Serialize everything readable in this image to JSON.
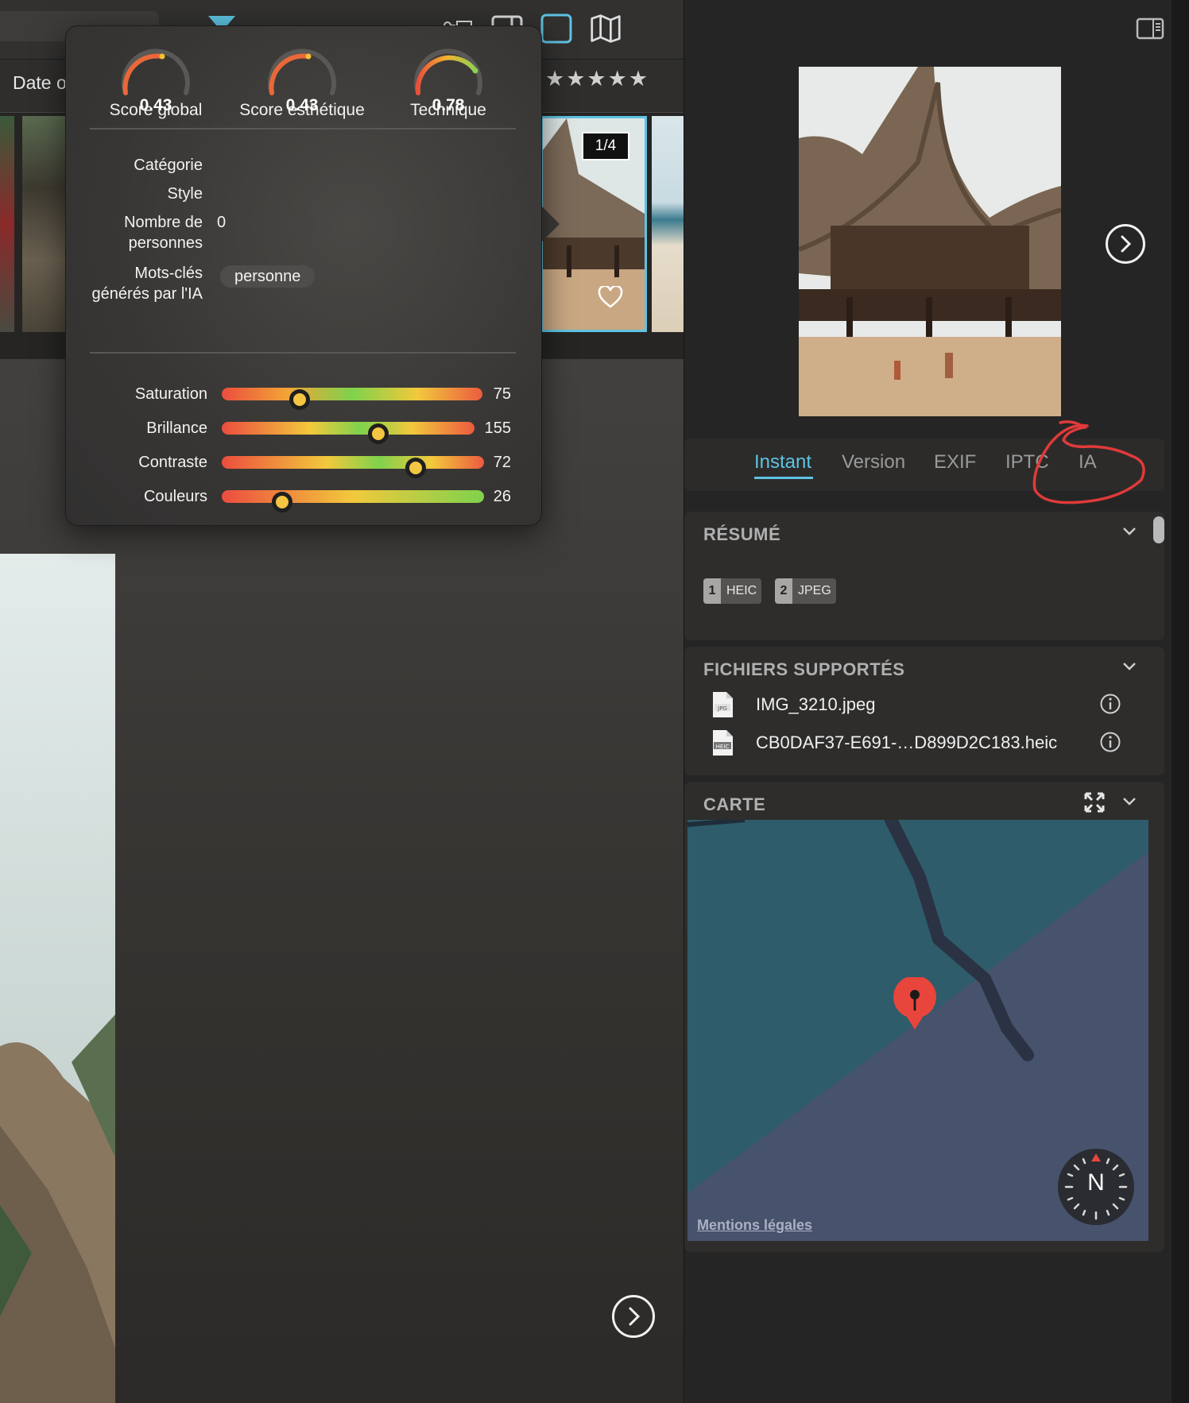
{
  "toolbar": {
    "sort_label": "Date o"
  },
  "filmstrip": {
    "badge": "1/4"
  },
  "popover": {
    "gauges": [
      {
        "value": "0.43",
        "label": "Score global"
      },
      {
        "value": "0.43",
        "label": "Score esthétique"
      },
      {
        "value": "0.78",
        "label": "Technique"
      }
    ],
    "meta": {
      "category_label": "Catégorie",
      "style_label": "Style",
      "people_label": "Nombre de personnes",
      "people_value": "0",
      "keywords_label": "Mots-clés générés par l'IA",
      "keyword_chip": "personne"
    },
    "sliders": [
      {
        "label": "Saturation",
        "value": "75",
        "level": 0.29
      },
      {
        "label": "Brillance",
        "value": "155",
        "level": 0.61
      },
      {
        "label": "Contraste",
        "value": "72",
        "level": 0.73
      },
      {
        "label": "Couleurs",
        "value": "26",
        "level": 0.22
      }
    ]
  },
  "inspector": {
    "tabs": [
      "Instant",
      "Version",
      "EXIF",
      "IPTC",
      "IA"
    ],
    "active_tab": "Instant",
    "summary": {
      "title": "RÉSUMÉ",
      "formats": [
        {
          "num": "1",
          "type": "HEIC"
        },
        {
          "num": "2",
          "type": "JPEG"
        }
      ]
    },
    "files": {
      "title": "FICHIERS SUPPORTÉS",
      "items": [
        {
          "icon": "jpg-file-icon",
          "icon_text": "JPG",
          "name": "IMG_3210.jpeg"
        },
        {
          "icon": "heic-file-icon",
          "icon_text": "HEIC",
          "name": "CB0DAF37-E691-…D899D2C183.heic"
        }
      ]
    },
    "map": {
      "title": "CARTE",
      "legal": "Mentions légales",
      "compass": "N"
    }
  },
  "colors": {
    "accent": "#5ec3e3",
    "pin": "#e8453c",
    "annotation": "#e03a3a"
  }
}
